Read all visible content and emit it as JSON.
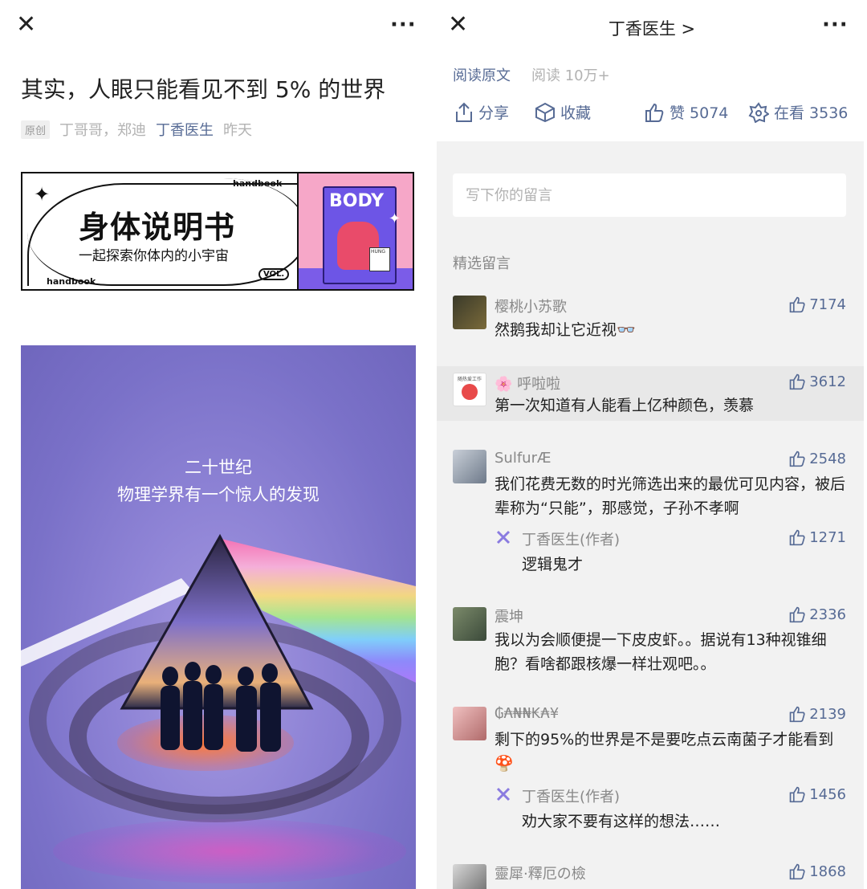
{
  "left": {
    "close_icon": "close-icon",
    "more_icon": "more-icon",
    "article_title": "其实，人眼只能看见不到 5% 的世界",
    "original_tag": "原创",
    "authors": "丁哥哥，郑迪",
    "account": "丁香医生",
    "time": "昨天",
    "banner": {
      "label_top": "handbook",
      "label_bottom": "handbook",
      "title": "身体说明书",
      "subtitle": "一起探索你体内的小宇宙",
      "vol": "VOL.",
      "book_title": "BODY",
      "note_label": "HUNG"
    },
    "poster": {
      "line1": "二十世纪",
      "line2": "物理学界有一个惊人的发现"
    }
  },
  "right": {
    "nav_title": "丁香医生 >",
    "read_original": "阅读原文",
    "read_count": "阅读 10万+",
    "share_label": "分享",
    "collect_label": "收藏",
    "like_label": "赞 5074",
    "wow_label": "在看 3536",
    "input_placeholder": "写下你的留言",
    "section_title": "精选留言",
    "comments": [
      {
        "name": "樱桃小苏歌",
        "likes": "7174",
        "text": "然鹅我却让它近视👓"
      },
      {
        "name": "🌸 呼啦啦",
        "likes": "3612",
        "text": "第一次知道有人能看上亿种颜色，羡慕",
        "avatar_caption": "随热爱工作"
      },
      {
        "name": "SulfurÆ",
        "likes": "2548",
        "text": "我们花费无数的时光筛选出来的最优可见内容，被后辈称为“只能”，那感觉，子孙不孝啊",
        "reply": {
          "name": "丁香医生(作者)",
          "likes": "1271",
          "text": "逻辑鬼才"
        }
      },
      {
        "name": "震坤",
        "likes": "2336",
        "text": "我以为会顺便提一下皮皮虾。。据说有13种视锥细胞？看啥都跟核爆一样壮观吧。。"
      },
      {
        "name": "₲₳₦₦₭₳¥",
        "likes": "2139",
        "text": "剩下的95%的世界是不是要吃点云南菌子才能看到🍄",
        "reply": {
          "name": "丁香医生(作者)",
          "likes": "1456",
          "text": "劝大家不要有这样的想法……"
        }
      },
      {
        "name": "靈犀·釋厄の檢",
        "likes": "1868",
        "text": ""
      }
    ]
  }
}
